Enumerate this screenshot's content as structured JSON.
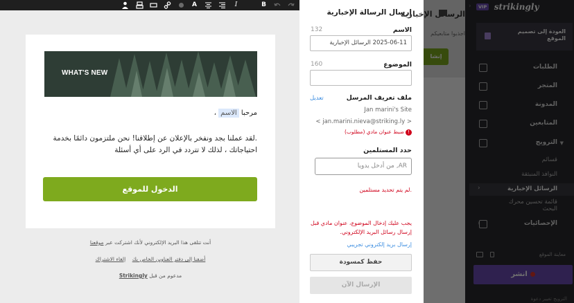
{
  "toolbar": {
    "icons": [
      "person-icon",
      "stamp-icon",
      "box-icon",
      "link-icon",
      "circle-icon",
      "text-color-icon",
      "align-center-icon",
      "align-right-icon",
      "italic-icon",
      "bold-icon",
      "undo-icon",
      "redo-icon"
    ],
    "glyphs": {
      "text_color": "A",
      "italic": "I",
      "bold": "B"
    }
  },
  "email": {
    "banner_title": "WHAT'S NEW",
    "greeting": "مرحبا",
    "name_token": "الاسم",
    "greeting_suffix": "،",
    "body": ".لقد عملنا بجد ونفخر بالإعلان عن إطلاقنا! نحن ملتزمون دائمًا بخدمة احتياجاتك ، لذلك لا تتردد في الرد على أي أسئلة",
    "cta_label": "الدخول للموقع",
    "footer": {
      "line1_prefix": "أنت تتلقى هذا البريد الإلكتروني لأنك اشتركت عبر",
      "line1_link": "موقعنا",
      "line2_link1": "أضفنا إلى دفتر العناوين الخاص بك",
      "line2_link2": "إلغاء الاشتراك",
      "line3_prefix": "مدعوم من قبل",
      "line3_brand": "Strikingly"
    }
  },
  "panel": {
    "title": "إرسال الرسالة الإخبارية",
    "name_label": "الاسم",
    "name_count": "132",
    "name_value": "2025-06-11 الرسائل الإخبارية",
    "subject_label": "الموضوع",
    "subject_count": "160",
    "subject_value": "",
    "sender_label": "ملف تعريف المرسل",
    "edit_link": "تعديل",
    "sender_site": "Jan marini's Site",
    "sender_email": "< jan.marini.nieva@striking.ly >",
    "sender_warning": "ضبط عنوان مادي (مطلوب)",
    "recipients_label": "حدد المستلمين",
    "recipients_placeholder": "AR, من أدخل يدويا",
    "no_recipients": ".لم يتم تحديد مستلمين",
    "validation": "يجب عليك إدخال الموضوع، عنوان مادي قبل إرسال رسائل البريد الإلكتروني.",
    "test_link": "إرسال بريد إلكتروني تجريبي",
    "draft_button": "حفظ كمسودة",
    "send_button": "الإرسال الآن"
  },
  "background": {
    "title": "الرسائل الإخبارية",
    "subtitle": "اجذبوا متابعيكم",
    "create_button": "إنشا"
  },
  "sidebar": {
    "vip": "VIP",
    "logo": "strikingly",
    "back": "العودة إلى تصميم الموقع",
    "nav": {
      "orders": "الطلبات",
      "store": "المتجر",
      "blog": "المدونة",
      "members": "المتابعين",
      "promotion": "الترويج",
      "analytics": "الإحصائيات"
    },
    "promotion_items": [
      "قسائم",
      "النوافذ المنبثقة",
      "الرسائل الإخبارية",
      "قائمة تحسين محرك البحث"
    ],
    "preview_label": "معاينة الموقع",
    "publish": "انشر",
    "footer": "الترويج    تغيير    دعوة"
  }
}
